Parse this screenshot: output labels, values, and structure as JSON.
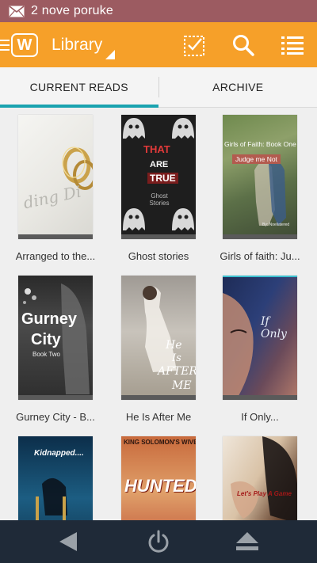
{
  "status_bar": {
    "notification_text": "2 nove poruke",
    "icon": "mail-icon"
  },
  "action_bar": {
    "title": "Library",
    "icons": [
      "app-logo-icon",
      "select-checkbox-icon",
      "search-icon",
      "list-menu-icon"
    ],
    "logo_letter": "W"
  },
  "tabs": [
    {
      "label": "CURRENT READS",
      "active": true
    },
    {
      "label": "ARCHIVE",
      "active": false
    }
  ],
  "books": [
    {
      "title": "Arranged to the...",
      "cover_text": [
        "ding Di"
      ]
    },
    {
      "title": "Ghost stories",
      "cover_text": [
        "THAT",
        "ARE",
        "TRUE",
        "Ghost Stories"
      ]
    },
    {
      "title": "Girls of faith: Ju...",
      "cover_text": [
        "Girls of Faith: Book One",
        "Judge me Not",
        "By: Noeliatered"
      ]
    },
    {
      "title": "Gurney City - B...",
      "cover_text": [
        "Gurney",
        "City",
        "Book Two"
      ]
    },
    {
      "title": "He Is After Me",
      "cover_text": [
        "He",
        "Is",
        "AFTER",
        "ME"
      ]
    },
    {
      "title": "If Only...",
      "cover_text": [
        "If Only"
      ]
    },
    {
      "title": "",
      "cover_text": [
        "Kidnapped...."
      ]
    },
    {
      "title": "",
      "cover_text": [
        "KING SOLOMON'S WIVES",
        "HUNTED"
      ]
    },
    {
      "title": "",
      "cover_text": [
        "Let's Play A Game"
      ]
    }
  ],
  "colors": {
    "status_bar": "#9c5b61",
    "accent": "#f6a029",
    "tab_indicator": "#1aa3b0",
    "nav_bar": "#1f2a38"
  },
  "nav_bar": {
    "buttons": [
      "back-icon",
      "power-icon",
      "eject-icon"
    ]
  }
}
